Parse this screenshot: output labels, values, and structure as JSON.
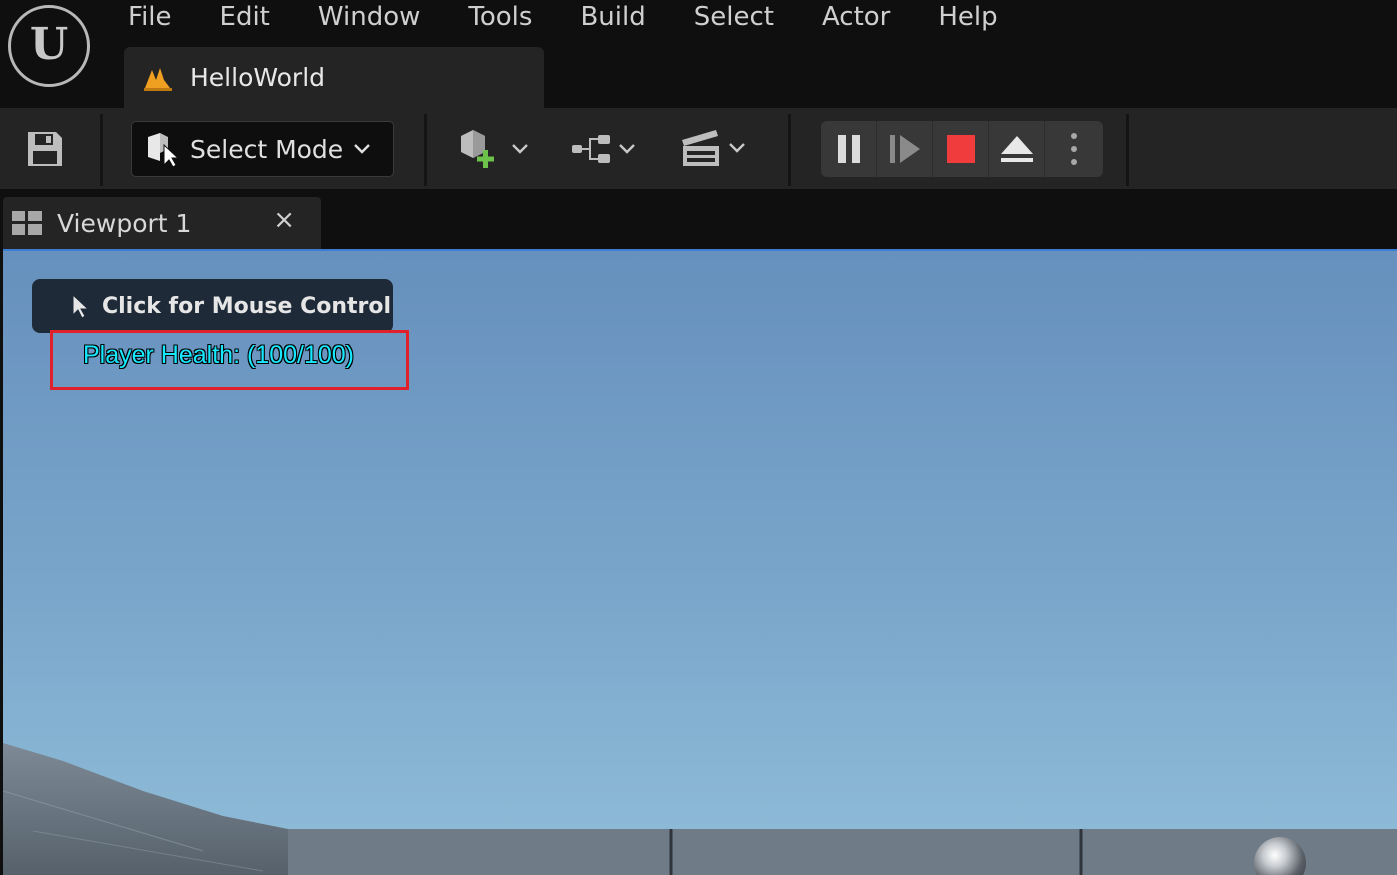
{
  "app": {
    "menu": [
      "File",
      "Edit",
      "Window",
      "Tools",
      "Build",
      "Select",
      "Actor",
      "Help"
    ],
    "document_tab": "HelloWorld"
  },
  "toolbar": {
    "mode_label": "Select Mode"
  },
  "viewport_tab": {
    "label": "Viewport 1",
    "close": "×"
  },
  "viewport": {
    "mouse_control_label": "Click for Mouse Control",
    "hud_health": "Player Health: (100/100)"
  },
  "colors": {
    "accent_stop": "#f03c3c",
    "hud_text": "#16e8ff",
    "highlight_box": "#e0202a",
    "level_icon": "#f0a020"
  }
}
